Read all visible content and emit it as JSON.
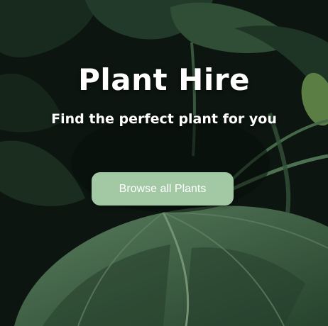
{
  "hero": {
    "title": "Plant Hire",
    "subtitle": "Find the perfect plant for you",
    "background_image": "monstera-leaves-photo"
  },
  "cta": {
    "label": "Browse all Plants",
    "color": "#a3c9a4"
  }
}
